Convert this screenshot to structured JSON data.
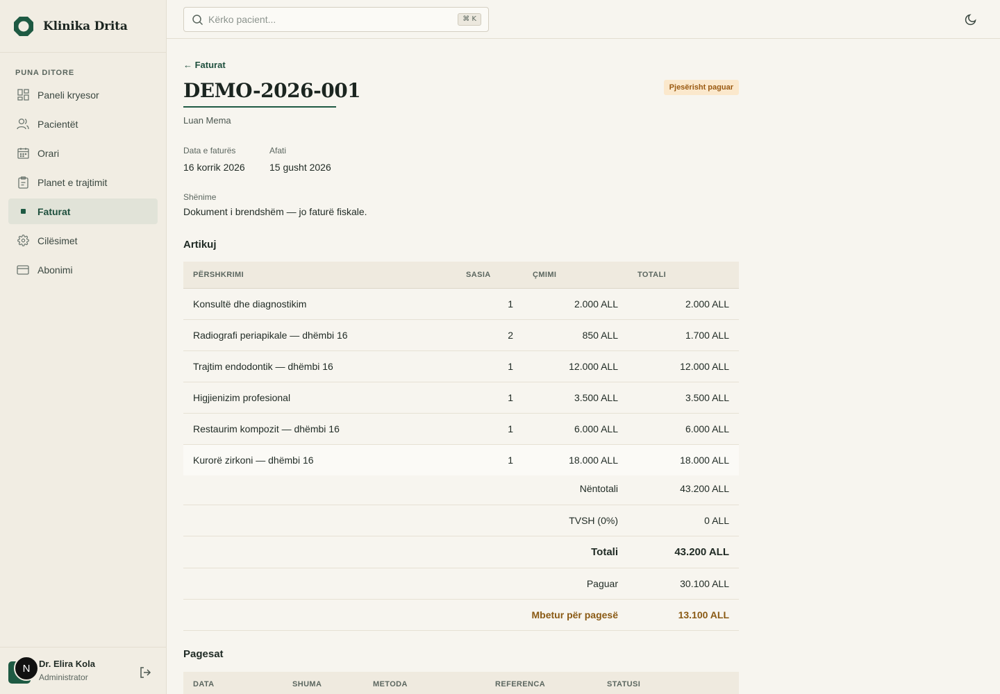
{
  "brand": {
    "name": "Klinika Drita"
  },
  "sidebar": {
    "section_label": "PUNA DITORE",
    "items": [
      {
        "label": "Paneli kryesor",
        "icon": "dashboard-icon"
      },
      {
        "label": "Pacientët",
        "icon": "users-icon"
      },
      {
        "label": "Orari",
        "icon": "calendar-icon"
      },
      {
        "label": "Planet e trajtimit",
        "icon": "clipboard-icon"
      },
      {
        "label": "Faturat",
        "icon": "active-dot-icon",
        "active": true
      },
      {
        "label": "Cilësimet",
        "icon": "gear-icon"
      },
      {
        "label": "Abonimi",
        "icon": "credit-card-icon"
      }
    ]
  },
  "user": {
    "name": "Dr. Elira Kola",
    "role": "Administrator",
    "initial": "N"
  },
  "search": {
    "placeholder": "Kërko pacient...",
    "shortcut": "⌘ K"
  },
  "invoice": {
    "back_label": "← Faturat",
    "number": "DEMO-2026-001",
    "status": "Pjesërisht paguar",
    "patient": "Luan Mema",
    "date_label": "Data e faturës",
    "date_value": "16 korrik 2026",
    "due_label": "Afati",
    "due_value": "15 gusht 2026",
    "notes_label": "Shënime",
    "notes_value": "Dokument i brendshëm — jo faturë fiskale."
  },
  "items": {
    "heading": "Artikuj",
    "columns": [
      "PËRSHKRIMI",
      "SASIA",
      "ÇMIMI",
      "TOTALI"
    ],
    "rows": [
      {
        "desc": "Konsultë dhe diagnostikim",
        "qty": "1",
        "price": "2.000 ALL",
        "total": "2.000 ALL"
      },
      {
        "desc": "Radiografi periapikale — dhëmbi 16",
        "qty": "2",
        "price": "850 ALL",
        "total": "1.700 ALL"
      },
      {
        "desc": "Trajtim endodontik — dhëmbi 16",
        "qty": "1",
        "price": "12.000 ALL",
        "total": "12.000 ALL"
      },
      {
        "desc": "Higjienizim profesional",
        "qty": "1",
        "price": "3.500 ALL",
        "total": "3.500 ALL"
      },
      {
        "desc": "Restaurim kompozit — dhëmbi 16",
        "qty": "1",
        "price": "6.000 ALL",
        "total": "6.000 ALL"
      },
      {
        "desc": "Kurorë zirkoni — dhëmbi 16",
        "qty": "1",
        "price": "18.000 ALL",
        "total": "18.000 ALL"
      }
    ]
  },
  "summary": {
    "subtotal_label": "Nëntotali",
    "subtotal_value": "43.200 ALL",
    "tax_label": "TVSH (0%)",
    "tax_value": "0 ALL",
    "total_label": "Totali",
    "total_value": "43.200 ALL",
    "paid_label": "Paguar",
    "paid_value": "30.100 ALL",
    "due_label": "Mbetur për pagesë",
    "due_value": "13.100 ALL"
  },
  "payments": {
    "heading": "Pagesat",
    "columns": [
      "DATA",
      "SHUMA",
      "METODA",
      "REFERENCA",
      "STATUSI"
    ]
  },
  "colors": {
    "accent": "#1e5a43",
    "status_bg": "#fbe8cc",
    "status_fg": "#9a5a12",
    "due": "#8a5a14"
  }
}
